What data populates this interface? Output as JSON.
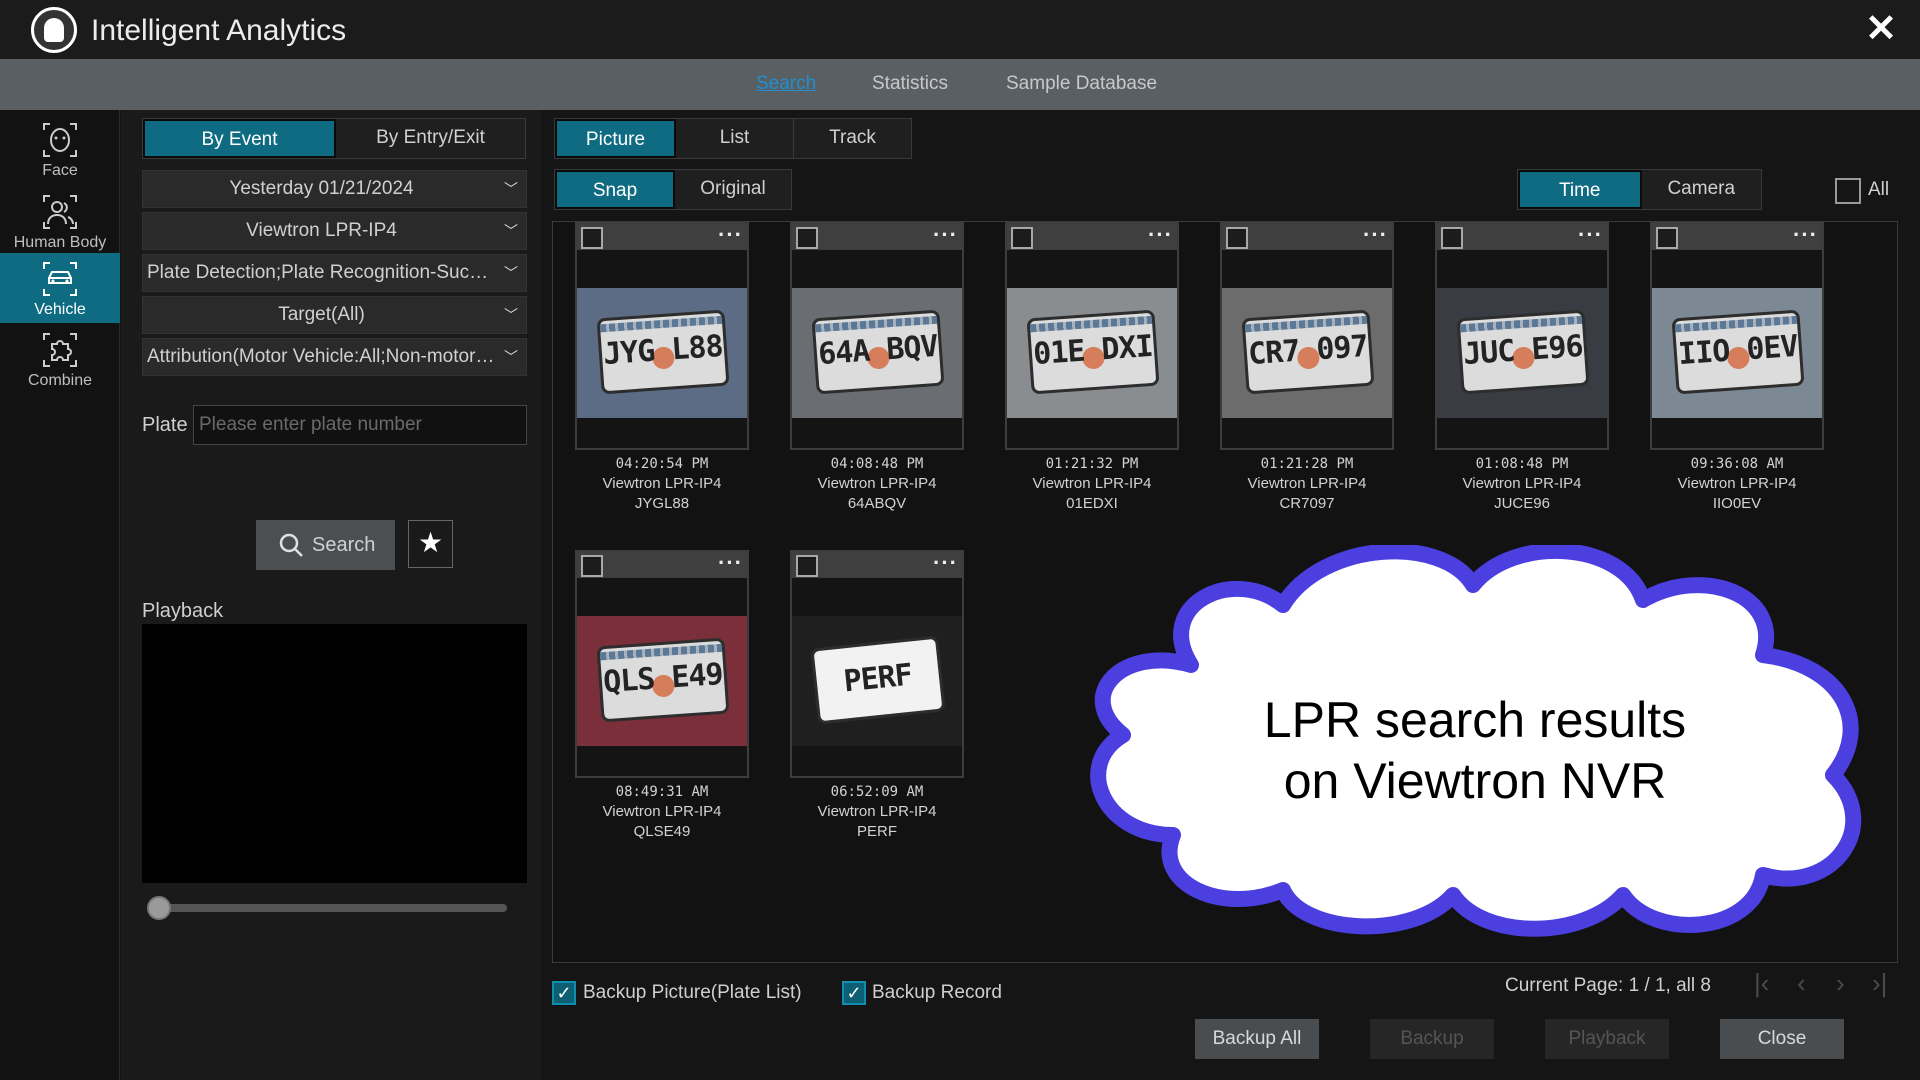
{
  "app": {
    "title": "Intelligent Analytics"
  },
  "tabs": [
    {
      "label": "Search",
      "active": true
    },
    {
      "label": "Statistics",
      "active": false
    },
    {
      "label": "Sample Database",
      "active": false
    }
  ],
  "nav": [
    {
      "label": "Face",
      "icon": "face-icon"
    },
    {
      "label": "Human Body",
      "icon": "human-body-icon"
    },
    {
      "label": "Vehicle",
      "icon": "vehicle-icon",
      "active": true
    },
    {
      "label": "Combine",
      "icon": "combine-icon"
    }
  ],
  "filter": {
    "mode_tabs": [
      "By Event",
      "By Entry/Exit"
    ],
    "date": "Yesterday 01/21/2024",
    "camera": "Viewtron LPR-IP4",
    "event": "Plate Detection;Plate Recognition-Success",
    "target": "Target(All)",
    "attribution": "Attribution(Motor Vehicle:All;Non-motor Vehicle:All)",
    "plate_label": "Plate",
    "plate_placeholder": "Please enter plate number",
    "search_label": "Search"
  },
  "playback": {
    "label": "Playback"
  },
  "view": {
    "type_tabs": [
      "Picture",
      "List",
      "Track"
    ],
    "image_tabs": [
      "Snap",
      "Original"
    ],
    "sort_tabs": [
      "Time",
      "Camera"
    ],
    "all_label": "All"
  },
  "results": [
    {
      "time": "04:20:54 PM",
      "camera": "Viewtron LPR-IP4",
      "plate": "JYGL88",
      "shown": "JYG L88",
      "bg": "#5c6c84"
    },
    {
      "time": "04:08:48 PM",
      "camera": "Viewtron LPR-IP4",
      "plate": "64ABQV",
      "shown": "64A BQV",
      "bg": "#6a6e73"
    },
    {
      "time": "01:21:32 PM",
      "camera": "Viewtron LPR-IP4",
      "plate": "01EDXI",
      "shown": "01E DXI",
      "bg": "#8a8d90"
    },
    {
      "time": "01:21:28 PM",
      "camera": "Viewtron LPR-IP4",
      "plate": "CR7097",
      "shown": "CR7 097",
      "bg": "#6c6c6c"
    },
    {
      "time": "01:08:48 PM",
      "camera": "Viewtron LPR-IP4",
      "plate": "JUCE96",
      "shown": "JUC E96",
      "bg": "#3a3c44"
    },
    {
      "time": "09:36:08 AM",
      "camera": "Viewtron LPR-IP4",
      "plate": "IIO0EV",
      "shown": "IIO 0EV",
      "bg": "#7d8895"
    },
    {
      "time": "08:49:31 AM",
      "camera": "Viewtron LPR-IP4",
      "plate": "QLSE49",
      "shown": "QLS E49",
      "bg": "#7a2f3a"
    },
    {
      "time": "06:52:09 AM",
      "camera": "Viewtron LPR-IP4",
      "plate": "PERF",
      "shown": "PERF",
      "bg": "#1f1f1f"
    }
  ],
  "callout": {
    "line1": "LPR search results",
    "line2": "on Viewtron NVR"
  },
  "backup_options": [
    {
      "label": "Backup Picture(Plate List)",
      "checked": true
    },
    {
      "label": "Backup Record",
      "checked": true
    }
  ],
  "pagination": {
    "text": "Current Page: 1 / 1, all 8"
  },
  "actions": [
    {
      "label": "Backup All",
      "enabled": true
    },
    {
      "label": "Backup",
      "enabled": false
    },
    {
      "label": "Playback",
      "enabled": false
    },
    {
      "label": "Close",
      "enabled": true
    }
  ],
  "colors": {
    "accent": "#0e6b82",
    "link": "#1f8fd0",
    "cloud_border": "#4b3fe0"
  }
}
